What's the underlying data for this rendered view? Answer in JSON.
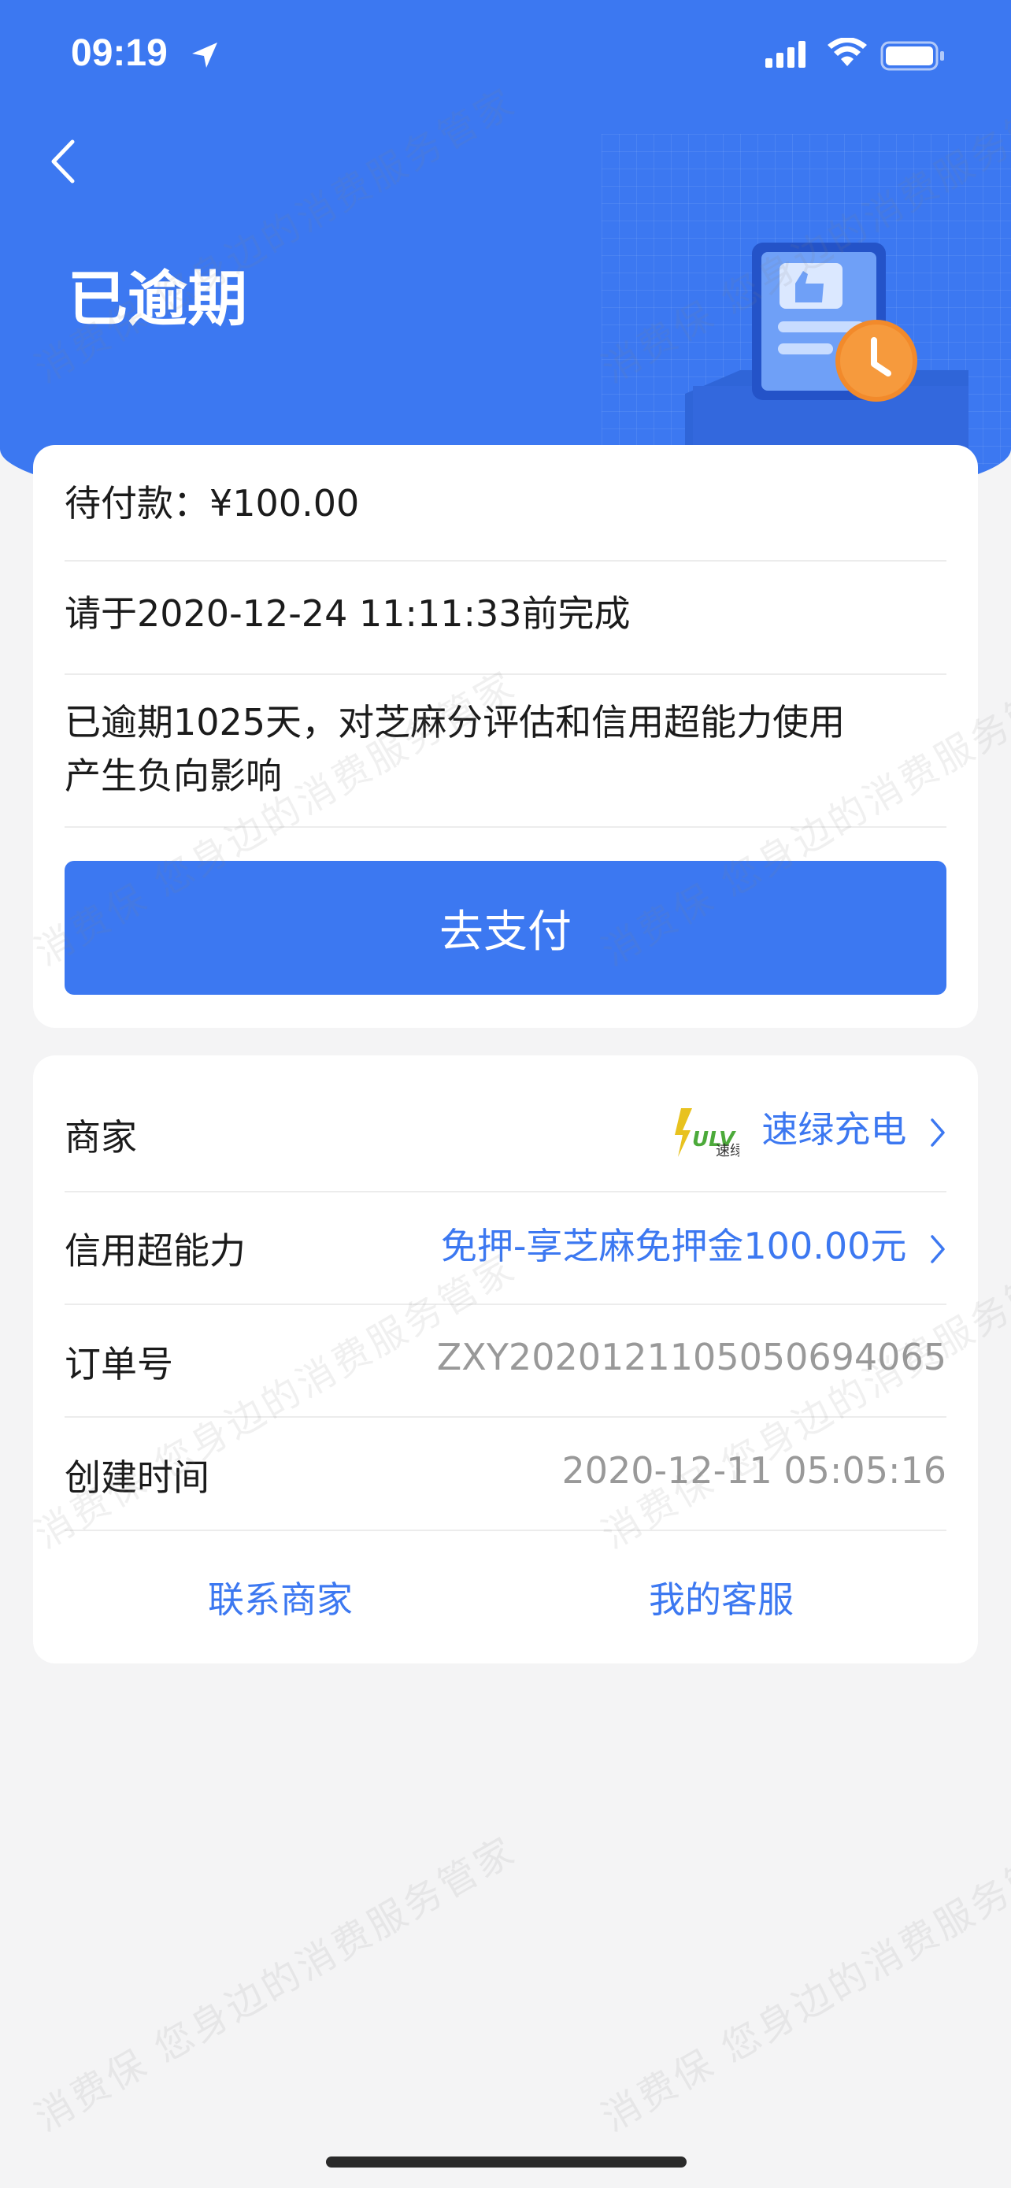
{
  "status_bar": {
    "time": "09:19"
  },
  "header": {
    "title": "已逾期"
  },
  "payment_card": {
    "amount_label": "待付款：¥100.00",
    "deadline": "请于2020-12-24 11:11:33前完成",
    "overdue_line1": "已逾期1025天，对芝麻分评估和信用超能力使用",
    "overdue_line2": "产生负向影响",
    "pay_button": "去支付"
  },
  "info_card": {
    "merchant_label": "商家",
    "merchant_logo_text": "速绿",
    "merchant_name": "速绿充电",
    "credit_label": "信用超能力",
    "credit_value": "免押-享芝麻免押金100.00元",
    "order_label": "订单号",
    "order_value": "ZXY20201211050506​94065",
    "created_label": "创建时间",
    "created_value": "2020-12-11 05:05:16",
    "contact_merchant": "联系商家",
    "my_service": "我的客服"
  },
  "watermark": "消费保 您身边的消费服务管家",
  "colors": {
    "brand_blue": "#3c78f1",
    "background": "#f4f4f5",
    "card": "#ffffff"
  }
}
